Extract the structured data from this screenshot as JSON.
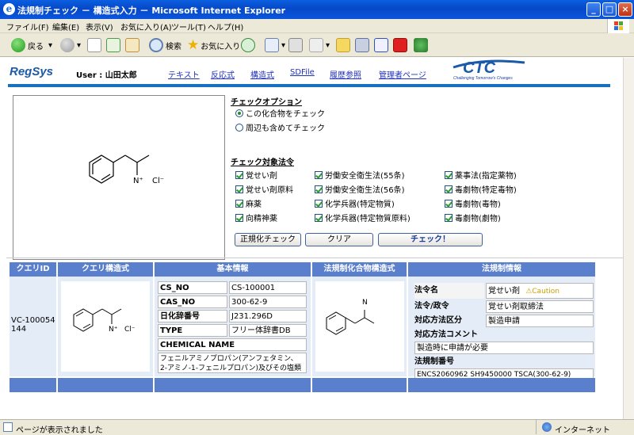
{
  "window": {
    "title": "法規制チェック － 構造式入力 － Microsoft Internet Explorer"
  },
  "menu": [
    "ファイル(F)",
    "編集(E)",
    "表示(V)",
    "お気に入り(A)",
    "ツール(T)",
    "ヘルプ(H)"
  ],
  "toolbar": {
    "back": "戻る",
    "search": "検索",
    "favorites": "お気に入り"
  },
  "header": {
    "logo": "RegSys",
    "user": "User : 山田太郎",
    "nav": [
      "テキスト",
      "反応式",
      "構造式",
      "SDFile",
      "履歴参照",
      "管理者ページ"
    ],
    "company": "CTC",
    "tagline": "Challenging Tomorrow's Changes"
  },
  "structure": {
    "n_label": "N⁺",
    "cl_label": "Cl⁻",
    "n_plain": "N"
  },
  "check_options": {
    "title": "チェックオプション",
    "items": [
      {
        "label": "この化合物をチェック",
        "selected": true
      },
      {
        "label": "周辺も含めてチェック",
        "selected": false
      }
    ]
  },
  "laws": {
    "title": "チェック対象法令",
    "items": [
      {
        "label": "覚せい剤",
        "checked": true
      },
      {
        "label": "覚せい剤原料",
        "checked": true
      },
      {
        "label": "麻薬",
        "checked": true
      },
      {
        "label": "向精神薬",
        "checked": true
      },
      {
        "label": "労働安全衛生法(55条)",
        "checked": true
      },
      {
        "label": "労働安全衛生法(56条)",
        "checked": true
      },
      {
        "label": "化学兵器(特定物質)",
        "checked": true
      },
      {
        "label": "化学兵器(特定物質原料)",
        "checked": true
      },
      {
        "label": "薬事法(指定薬物)",
        "checked": true
      },
      {
        "label": "毒劇物(特定毒物)",
        "checked": true
      },
      {
        "label": "毒劇物(毒物)",
        "checked": true
      },
      {
        "label": "毒劇物(劇物)",
        "checked": true
      }
    ]
  },
  "buttons": {
    "regex": "正規化チェック",
    "clear": "クリア",
    "check": "チェック！"
  },
  "results": {
    "headers": [
      "クエリID",
      "クエリ構造式",
      "基本情報",
      "法規制化合物構造式",
      "法規制情報"
    ],
    "query_id": "VC-100054144",
    "basic": [
      {
        "key": "CS_NO",
        "value": "CS-100001"
      },
      {
        "key": "CAS_NO",
        "value": "300-62-9"
      },
      {
        "key": "日化辞番号",
        "value": "J231.296D"
      },
      {
        "key": "TYPE",
        "value": "フリー体辞書DB"
      }
    ],
    "chemical_name_label": "CHEMICAL NAME",
    "chemical_name": "フェニルアミノプロパン(アンフェタミン、2-アミノ-1-フェニルプロパン)及びその塩類",
    "regulation": {
      "law_name_label": "法令名",
      "law_name": "覚せい剤",
      "caution": "Caution",
      "law_order_label": "法令/政令",
      "law_order": "覚せい剤取締法",
      "method_label": "対応方法区分",
      "method": "製造申請",
      "comment_label": "対応方法コメント",
      "comment": "製造時に申請が必要",
      "number_label": "法規制番号",
      "number": "ENCS2060962 SH9450000 TSCA(300-62-9)"
    }
  },
  "status": {
    "left": "ページが表示されました",
    "zone": "インターネット"
  }
}
